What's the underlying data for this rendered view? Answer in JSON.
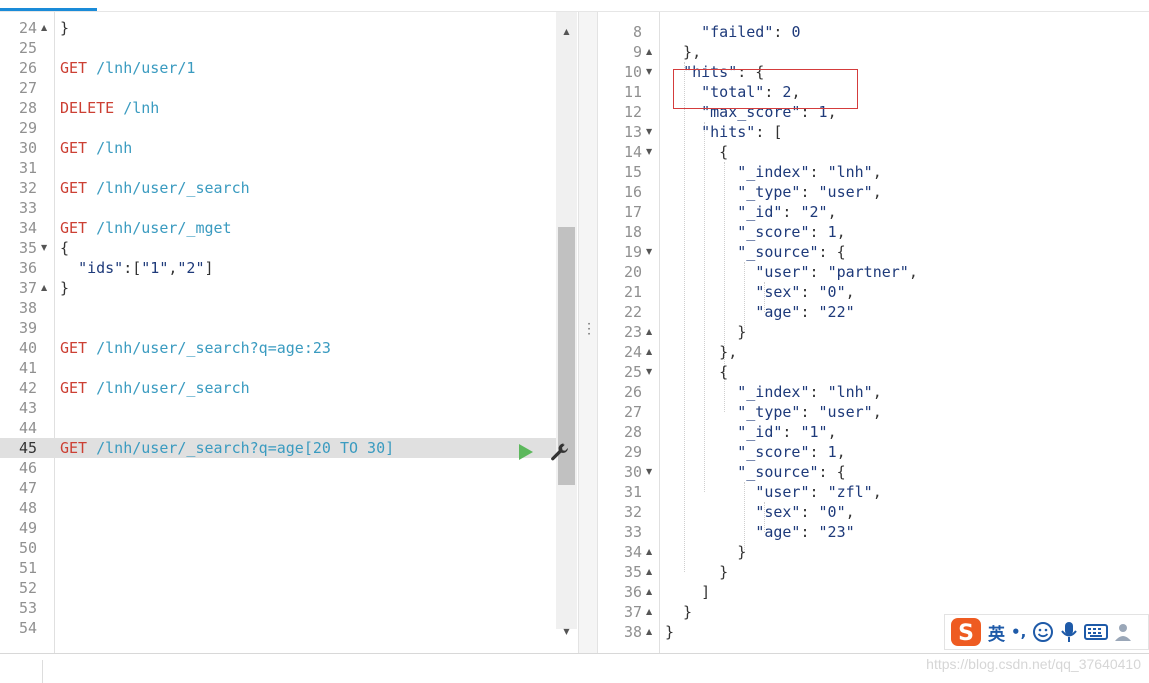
{
  "left_editor": {
    "lines": [
      {
        "n": "24",
        "fold": "up",
        "parts": [
          [
            "punc",
            "}"
          ]
        ]
      },
      {
        "n": "25",
        "parts": []
      },
      {
        "n": "26",
        "parts": [
          [
            "method",
            "GET"
          ],
          [
            "punc",
            " "
          ],
          [
            "path",
            "/lnh/user/1"
          ]
        ]
      },
      {
        "n": "27",
        "parts": []
      },
      {
        "n": "28",
        "parts": [
          [
            "method",
            "DELETE"
          ],
          [
            "punc",
            " "
          ],
          [
            "path",
            "/lnh"
          ]
        ]
      },
      {
        "n": "29",
        "parts": []
      },
      {
        "n": "30",
        "parts": [
          [
            "method",
            "GET"
          ],
          [
            "punc",
            " "
          ],
          [
            "path",
            "/lnh"
          ]
        ]
      },
      {
        "n": "31",
        "parts": []
      },
      {
        "n": "32",
        "parts": [
          [
            "method",
            "GET"
          ],
          [
            "punc",
            " "
          ],
          [
            "path",
            "/lnh/user/_search"
          ]
        ]
      },
      {
        "n": "33",
        "parts": []
      },
      {
        "n": "34",
        "parts": [
          [
            "method",
            "GET"
          ],
          [
            "punc",
            " "
          ],
          [
            "path",
            "/lnh/user/_mget"
          ]
        ]
      },
      {
        "n": "35",
        "fold": "down",
        "parts": [
          [
            "punc",
            "{"
          ]
        ]
      },
      {
        "n": "36",
        "parts": [
          [
            "punc",
            "  "
          ],
          [
            "key",
            "\"ids\""
          ],
          [
            "punc",
            ":["
          ],
          [
            "str",
            "\"1\""
          ],
          [
            "punc",
            ","
          ],
          [
            "str",
            "\"2\""
          ],
          [
            "punc",
            "]"
          ]
        ]
      },
      {
        "n": "37",
        "fold": "up",
        "parts": [
          [
            "punc",
            "}"
          ]
        ]
      },
      {
        "n": "38",
        "parts": []
      },
      {
        "n": "39",
        "parts": []
      },
      {
        "n": "40",
        "parts": [
          [
            "method",
            "GET"
          ],
          [
            "punc",
            " "
          ],
          [
            "path",
            "/lnh/user/_search?q=age:23"
          ]
        ]
      },
      {
        "n": "41",
        "parts": []
      },
      {
        "n": "42",
        "parts": [
          [
            "method",
            "GET"
          ],
          [
            "punc",
            " "
          ],
          [
            "path",
            "/lnh/user/_search"
          ]
        ]
      },
      {
        "n": "43",
        "parts": []
      },
      {
        "n": "44",
        "parts": []
      },
      {
        "n": "45",
        "active": true,
        "parts": [
          [
            "method",
            "GET"
          ],
          [
            "punc",
            " "
          ],
          [
            "path",
            "/lnh/user/_search?q=age[20 TO 30]"
          ]
        ]
      },
      {
        "n": "46",
        "parts": []
      },
      {
        "n": "47",
        "parts": []
      },
      {
        "n": "48",
        "parts": []
      },
      {
        "n": "49",
        "parts": []
      },
      {
        "n": "50",
        "parts": []
      },
      {
        "n": "51",
        "parts": []
      },
      {
        "n": "52",
        "parts": []
      },
      {
        "n": "53",
        "parts": []
      },
      {
        "n": "54",
        "parts": []
      }
    ]
  },
  "right_editor": {
    "lines": [
      {
        "n": "8",
        "parts": [
          [
            "punc",
            "    "
          ],
          [
            "key",
            "\"failed\""
          ],
          [
            "punc",
            ": "
          ],
          [
            "num",
            "0"
          ]
        ]
      },
      {
        "n": "9",
        "fold": "up",
        "parts": [
          [
            "punc",
            "  },"
          ]
        ]
      },
      {
        "n": "10",
        "fold": "down",
        "parts": [
          [
            "punc",
            "  "
          ],
          [
            "key",
            "\"hits\""
          ],
          [
            "punc",
            ": {"
          ]
        ]
      },
      {
        "n": "11",
        "parts": [
          [
            "punc",
            "    "
          ],
          [
            "key",
            "\"total\""
          ],
          [
            "punc",
            ": "
          ],
          [
            "num",
            "2"
          ],
          [
            "punc",
            ","
          ]
        ]
      },
      {
        "n": "12",
        "parts": [
          [
            "punc",
            "    "
          ],
          [
            "key",
            "\"max_score\""
          ],
          [
            "punc",
            ": "
          ],
          [
            "num",
            "1"
          ],
          [
            "punc",
            ","
          ]
        ]
      },
      {
        "n": "13",
        "fold": "down",
        "parts": [
          [
            "punc",
            "    "
          ],
          [
            "key",
            "\"hits\""
          ],
          [
            "punc",
            ": ["
          ]
        ]
      },
      {
        "n": "14",
        "fold": "down",
        "parts": [
          [
            "punc",
            "      {"
          ]
        ]
      },
      {
        "n": "15",
        "parts": [
          [
            "punc",
            "        "
          ],
          [
            "key",
            "\"_index\""
          ],
          [
            "punc",
            ": "
          ],
          [
            "str",
            "\"lnh\""
          ],
          [
            "punc",
            ","
          ]
        ]
      },
      {
        "n": "16",
        "parts": [
          [
            "punc",
            "        "
          ],
          [
            "key",
            "\"_type\""
          ],
          [
            "punc",
            ": "
          ],
          [
            "str",
            "\"user\""
          ],
          [
            "punc",
            ","
          ]
        ]
      },
      {
        "n": "17",
        "parts": [
          [
            "punc",
            "        "
          ],
          [
            "key",
            "\"_id\""
          ],
          [
            "punc",
            ": "
          ],
          [
            "str",
            "\"2\""
          ],
          [
            "punc",
            ","
          ]
        ]
      },
      {
        "n": "18",
        "parts": [
          [
            "punc",
            "        "
          ],
          [
            "key",
            "\"_score\""
          ],
          [
            "punc",
            ": "
          ],
          [
            "num",
            "1"
          ],
          [
            "punc",
            ","
          ]
        ]
      },
      {
        "n": "19",
        "fold": "down",
        "parts": [
          [
            "punc",
            "        "
          ],
          [
            "key",
            "\"_source\""
          ],
          [
            "punc",
            ": {"
          ]
        ]
      },
      {
        "n": "20",
        "parts": [
          [
            "punc",
            "          "
          ],
          [
            "key",
            "\"user\""
          ],
          [
            "punc",
            ": "
          ],
          [
            "str",
            "\"partner\""
          ],
          [
            "punc",
            ","
          ]
        ]
      },
      {
        "n": "21",
        "parts": [
          [
            "punc",
            "          "
          ],
          [
            "key",
            "\"sex\""
          ],
          [
            "punc",
            ": "
          ],
          [
            "str",
            "\"0\""
          ],
          [
            "punc",
            ","
          ]
        ]
      },
      {
        "n": "22",
        "parts": [
          [
            "punc",
            "          "
          ],
          [
            "key",
            "\"age\""
          ],
          [
            "punc",
            ": "
          ],
          [
            "str",
            "\"22\""
          ]
        ]
      },
      {
        "n": "23",
        "fold": "up",
        "parts": [
          [
            "punc",
            "        }"
          ]
        ]
      },
      {
        "n": "24",
        "fold": "up",
        "parts": [
          [
            "punc",
            "      },"
          ]
        ]
      },
      {
        "n": "25",
        "fold": "down",
        "parts": [
          [
            "punc",
            "      {"
          ]
        ]
      },
      {
        "n": "26",
        "parts": [
          [
            "punc",
            "        "
          ],
          [
            "key",
            "\"_index\""
          ],
          [
            "punc",
            ": "
          ],
          [
            "str",
            "\"lnh\""
          ],
          [
            "punc",
            ","
          ]
        ]
      },
      {
        "n": "27",
        "parts": [
          [
            "punc",
            "        "
          ],
          [
            "key",
            "\"_type\""
          ],
          [
            "punc",
            ": "
          ],
          [
            "str",
            "\"user\""
          ],
          [
            "punc",
            ","
          ]
        ]
      },
      {
        "n": "28",
        "parts": [
          [
            "punc",
            "        "
          ],
          [
            "key",
            "\"_id\""
          ],
          [
            "punc",
            ": "
          ],
          [
            "str",
            "\"1\""
          ],
          [
            "punc",
            ","
          ]
        ]
      },
      {
        "n": "29",
        "parts": [
          [
            "punc",
            "        "
          ],
          [
            "key",
            "\"_score\""
          ],
          [
            "punc",
            ": "
          ],
          [
            "num",
            "1"
          ],
          [
            "punc",
            ","
          ]
        ]
      },
      {
        "n": "30",
        "fold": "down",
        "parts": [
          [
            "punc",
            "        "
          ],
          [
            "key",
            "\"_source\""
          ],
          [
            "punc",
            ": {"
          ]
        ]
      },
      {
        "n": "31",
        "parts": [
          [
            "punc",
            "          "
          ],
          [
            "key",
            "\"user\""
          ],
          [
            "punc",
            ": "
          ],
          [
            "str",
            "\"zfl\""
          ],
          [
            "punc",
            ","
          ]
        ]
      },
      {
        "n": "32",
        "parts": [
          [
            "punc",
            "          "
          ],
          [
            "key",
            "\"sex\""
          ],
          [
            "punc",
            ": "
          ],
          [
            "str",
            "\"0\""
          ],
          [
            "punc",
            ","
          ]
        ]
      },
      {
        "n": "33",
        "parts": [
          [
            "punc",
            "          "
          ],
          [
            "key",
            "\"age\""
          ],
          [
            "punc",
            ": "
          ],
          [
            "str",
            "\"23\""
          ]
        ]
      },
      {
        "n": "34",
        "fold": "up",
        "parts": [
          [
            "punc",
            "        }"
          ]
        ]
      },
      {
        "n": "35",
        "fold": "up",
        "parts": [
          [
            "punc",
            "      }"
          ]
        ]
      },
      {
        "n": "36",
        "fold": "up",
        "parts": [
          [
            "punc",
            "    ]"
          ]
        ]
      },
      {
        "n": "37",
        "fold": "up",
        "parts": [
          [
            "punc",
            "  }"
          ]
        ]
      },
      {
        "n": "38",
        "fold": "up",
        "parts": [
          [
            "punc",
            "}"
          ]
        ]
      }
    ]
  },
  "icons": {
    "play": "play-icon",
    "wrench": "wrench-icon",
    "pane_resize": "vertical-dots-icon",
    "ime_logo": "sogou-logo-icon",
    "ime_punct": "punctuation-icon",
    "ime_emoji": "smiley-icon",
    "ime_mic": "microphone-icon",
    "ime_keyboard": "keyboard-icon",
    "ime_user": "user-icon"
  },
  "ime": {
    "lang_label": "英",
    "punct_label": "•,"
  },
  "watermark": "https://blog.csdn.net/qq_37640410",
  "colors": {
    "method": "#cc3f33",
    "path": "#3a9bc0",
    "json_key": "#1e3a7a",
    "accent_tab": "#1a8bd8",
    "highlight_box": "#d43c3c",
    "play_green": "#5cb85c",
    "ime_orange": "#ee5b21"
  }
}
